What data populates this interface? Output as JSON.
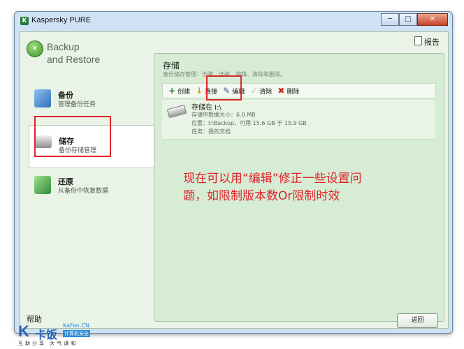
{
  "window": {
    "title": "Kaspersky PURE",
    "app_icon": "K",
    "controls": {
      "min": "─",
      "max": "□",
      "close": "✕"
    }
  },
  "section": {
    "title": "Backup\nand Restore"
  },
  "header": {
    "report_label": "报告"
  },
  "sidebar": {
    "items": [
      {
        "title": "备份",
        "subtitle": "管理备份任务"
      },
      {
        "title": "储存",
        "subtitle": "备份存储管理"
      },
      {
        "title": "还原",
        "subtitle": "从备份中恢复数据"
      }
    ]
  },
  "panel": {
    "title": "存储",
    "description": "备份储存管理：创建、连接、编辑、清除和删除。",
    "toolbar": [
      {
        "icon": "+",
        "label": "创建",
        "color": "#2b8a2b"
      },
      {
        "icon": "↓",
        "label": "连接",
        "color": "#d89a12"
      },
      {
        "icon": "✎",
        "label": "编辑",
        "color": "#3a5a8a"
      },
      {
        "icon": "✓",
        "label": "清除",
        "color": "#b8b8b8"
      },
      {
        "icon": "✖",
        "label": "删除",
        "color": "#d02020"
      }
    ],
    "storage": {
      "name": "存储在 I:\\",
      "size_line": "存储中数据大小：6.0 MB",
      "location_line": "位置：I:\\Backup，可用 15.6 GB 于 15.9 GB",
      "task_line": "任务：我的文档"
    }
  },
  "annotation": {
    "text": "现在可以用“编辑”修正一些设置问\n题，如限制版本数Or限制时效",
    "color": "#e0252b"
  },
  "footer": {
    "help_label": "帮助",
    "return_label": "返回"
  },
  "watermark": {
    "k": "K",
    "name": "卡饭",
    "domain": "KaFan.CN",
    "tag": "计算机安全",
    "bottom": "互助分享  大气谦和"
  },
  "colors": {
    "accent": "#3f8f2e",
    "annotation": "#e0252b",
    "panel_bg": "#d7ecd4"
  }
}
